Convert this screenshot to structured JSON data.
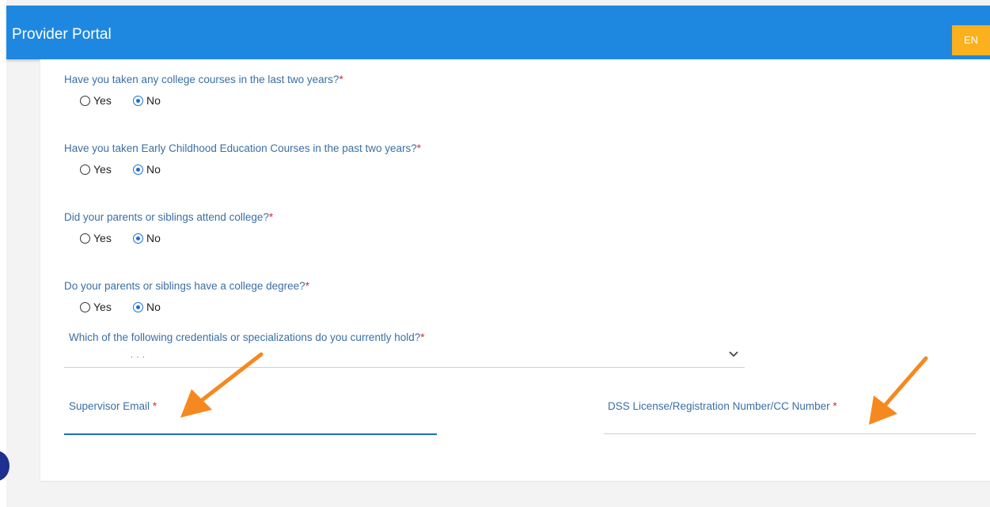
{
  "header": {
    "title": "Provider Portal",
    "language_button": "EN"
  },
  "questions": [
    {
      "text": "Have you taken any college courses in the last two years?",
      "required_mark": "*",
      "options": [
        "Yes",
        "No"
      ],
      "selected": "No"
    },
    {
      "text": "Have you taken Early Childhood Education Courses in the past two years?",
      "required_mark": "*",
      "options": [
        "Yes",
        "No"
      ],
      "selected": "No"
    },
    {
      "text": "Did your parents or siblings attend college?",
      "required_mark": "*",
      "options": [
        "Yes",
        "No"
      ],
      "selected": "No"
    },
    {
      "text": "Do your parents or siblings have a college degree?",
      "required_mark": "*",
      "options": [
        "Yes",
        "No"
      ],
      "selected": "No"
    }
  ],
  "credentials": {
    "label": "Which of the following credentials or specializations do you currently hold?",
    "required_mark": "*",
    "placeholder": ". . ."
  },
  "supervisor_email": {
    "label": "Supervisor Email",
    "required_mark": "*"
  },
  "license_number": {
    "label": "DSS License/Registration Number/CC Number",
    "required_mark": "*"
  },
  "colors": {
    "header": "#1e88e0",
    "lang_button": "#fbb11d",
    "arrow": "#f5891f",
    "label": "#3a6fa5"
  }
}
